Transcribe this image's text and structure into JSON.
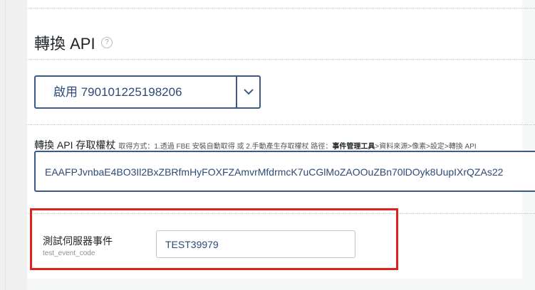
{
  "section": {
    "title": "轉換 API",
    "help_icon": "question-circle-icon"
  },
  "status_select": {
    "selected": "啟用 790101225198206",
    "arrow_icon": "chevron-down-icon"
  },
  "access_token": {
    "label": "轉換 API 存取權杖",
    "hint_prefix": "取得方式：1.透過 FBE 安裝自動取得  或  2.手動產生存取權杖 路徑：",
    "hint_link": "事件管理工具",
    "hint_suffix": ">資料來源>像素>設定>轉換 API",
    "value": "EAAFPJvnbaE4BO3Il2BxZBRfmHyFOXFZAmvrMfdrmcK7uCGlMoZAOOuZBn70lDOyk8UupIXrQZAs22"
  },
  "test_event": {
    "label": "測試伺服器事件",
    "sublabel": "test_event_code",
    "value": "TEST39979"
  },
  "colors": {
    "accent": "#3b5a8a",
    "highlight": "#e0221c"
  }
}
